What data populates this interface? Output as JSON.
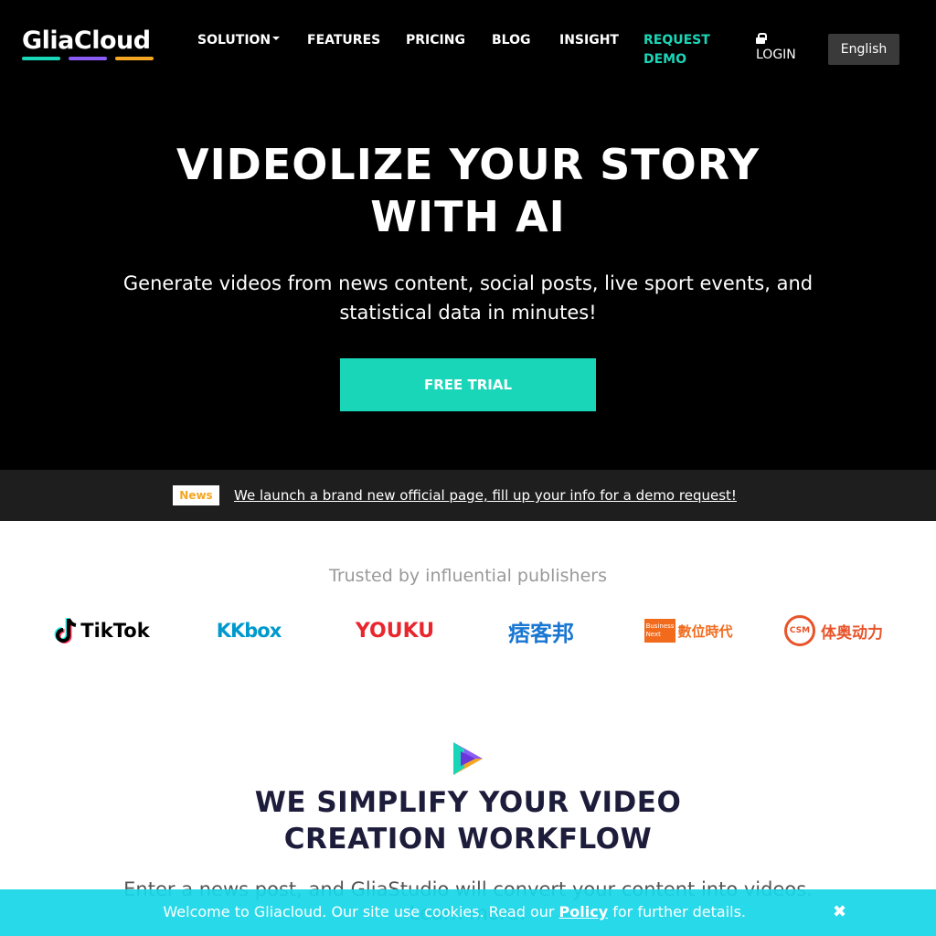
{
  "nav": {
    "logo_text": "GliaCloud",
    "logo_colors": [
      "#1ad6b8",
      "#8b5cf6",
      "#f5a623"
    ],
    "items": [
      {
        "label": "SOLUTION",
        "has_dropdown": true
      },
      {
        "label": "FEATURES"
      },
      {
        "label": "PRICING"
      },
      {
        "label": "BLOG"
      },
      {
        "label": "INSIGHT"
      },
      {
        "label": "REQUEST\nDEMO"
      }
    ],
    "login_label": "LOGIN",
    "language": "English"
  },
  "hero": {
    "title_line1": "VIDEOLIZE YOUR STORY",
    "title_line2": "WITH AI",
    "subtitle": "Generate videos from news content, social posts, live sport events, and statistical data in minutes!",
    "cta_label": "FREE TRIAL"
  },
  "news": {
    "badge": "News",
    "text": "We launch a brand new official page, fill up your info for a demo request!"
  },
  "trusted": {
    "heading": "Trusted by influential publishers",
    "brands": [
      "TikTok",
      "KKbox",
      "YOUKU",
      "痞客邦",
      "數位時代",
      "体奥动力"
    ],
    "brand_small": {
      "bnext": "Business Next",
      "csm": "CSM"
    }
  },
  "workflow": {
    "title_line1": "WE SIMPLIFY YOUR VIDEO",
    "title_line2": "CREATION WORKFLOW",
    "description": "Enter a news post, and GliaStudio will convert your content into videos. Learn more!"
  },
  "cookie": {
    "text_before": "Welcome to Gliacloud. Our site use cookies. Read our ",
    "policy_label": "Policy",
    "text_after": " for further details.",
    "close_icon": "✖"
  },
  "colors": {
    "accent": "#1ad6b8",
    "cookie_bar": "#18d6e8",
    "news_badge_text": "#f5a623",
    "title_dark": "#1d1d3b"
  }
}
